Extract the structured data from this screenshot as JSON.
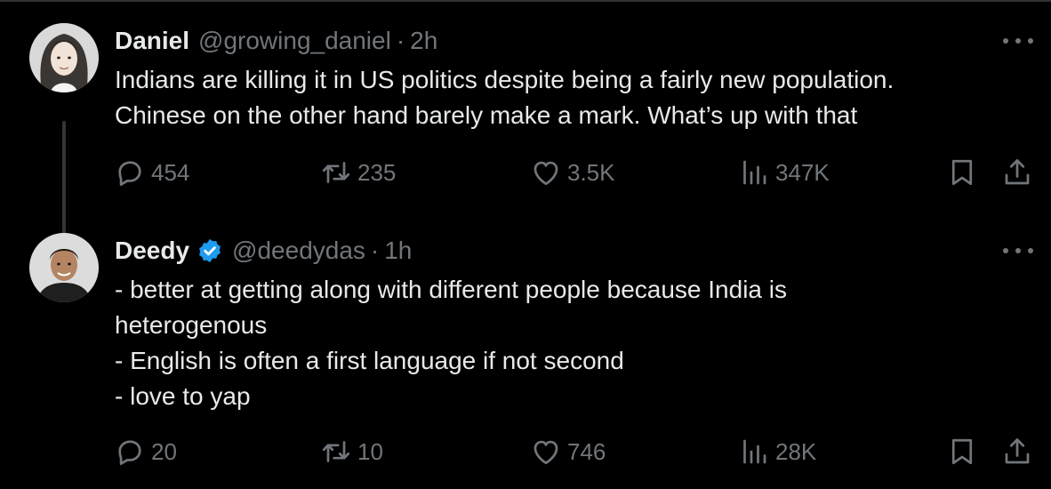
{
  "tweets": [
    {
      "name": "Daniel",
      "handle": "@growing_daniel",
      "separator": "·",
      "time": "2h",
      "verified": false,
      "lines": [
        "Indians are killing it in US politics despite being a fairly new population.",
        "Chinese on the other hand barely make a mark. What’s up with that"
      ],
      "replies": "454",
      "retweets": "235",
      "likes": "3.5K",
      "views": "347K"
    },
    {
      "name": "Deedy",
      "handle": "@deedydas",
      "separator": "·",
      "time": "1h",
      "verified": true,
      "lines": [
        "- better at getting along with different people because India is",
        "heterogenous",
        "- English is often a first language if not second",
        "- love to yap"
      ],
      "replies": "20",
      "retweets": "10",
      "likes": "746",
      "views": "28K"
    }
  ],
  "icons": {
    "reply": "speech-bubble",
    "retweet": "retweet-arrows",
    "like": "heart",
    "views": "bar-chart",
    "bookmark": "bookmark",
    "share": "upload-arrow",
    "more": "three-dots"
  },
  "colors": {
    "background": "#000000",
    "text": "#e7e9ea",
    "secondary": "#71767b",
    "verified": "#1d9bf0",
    "thread_line": "#333639"
  }
}
